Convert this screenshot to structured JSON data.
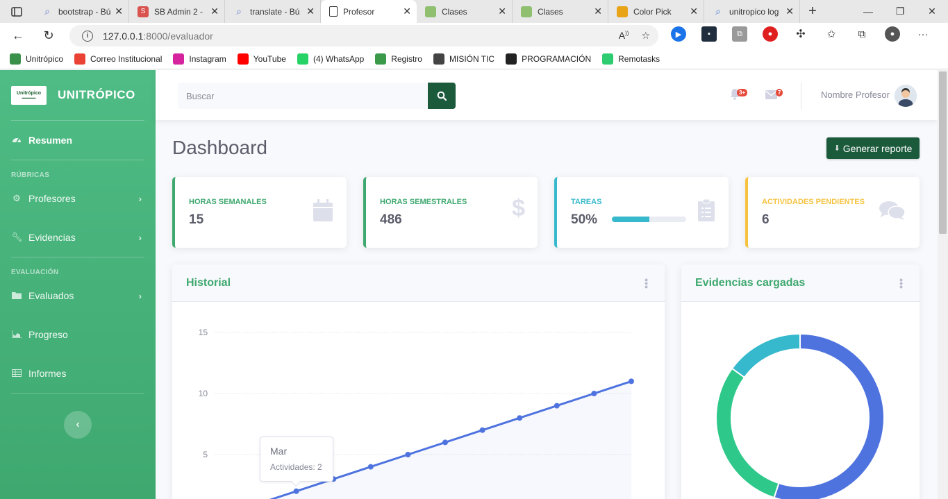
{
  "browser": {
    "tabs": [
      {
        "title": "bootstrap - Bú",
        "icon_color": "#6b7bd3",
        "icon": "search-icon",
        "active": false
      },
      {
        "title": "SB Admin 2 -",
        "icon_color": "#d9534f",
        "icon": "s-logo-icon",
        "active": false
      },
      {
        "title": "translate - Bú",
        "icon_color": "#6b7bd3",
        "icon": "search-icon",
        "active": false
      },
      {
        "title": "Profesor",
        "icon_color": "#ffffff",
        "icon": "document-icon",
        "active": true
      },
      {
        "title": "Clases",
        "icon_color": "#8fbf6f",
        "icon": "classroom-icon",
        "active": false
      },
      {
        "title": "Clases",
        "icon_color": "#8fbf6f",
        "icon": "classroom-icon",
        "active": false
      },
      {
        "title": "Color Pick",
        "icon_color": "#e8a317",
        "icon": "color-picker-icon",
        "active": false
      },
      {
        "title": "unitropico log",
        "icon_color": "#4a7bd3",
        "icon": "search-icon",
        "active": false
      }
    ],
    "url_host": "127.0.0.1",
    "url_path": ":8000/evaluador",
    "bookmarks": [
      {
        "label": "Unitrópico",
        "color": "#3a8f4a",
        "icon": "unitropico-icon"
      },
      {
        "label": "Correo Institucional",
        "color": "#ea4335",
        "icon": "gmail-icon"
      },
      {
        "label": "Instagram",
        "color": "#d6249f",
        "icon": "instagram-icon"
      },
      {
        "label": "YouTube",
        "color": "#ff0000",
        "icon": "youtube-icon"
      },
      {
        "label": "(4) WhatsApp",
        "color": "#25d366",
        "icon": "whatsapp-icon"
      },
      {
        "label": "Registro",
        "color": "#3a9a4a",
        "icon": "registro-icon"
      },
      {
        "label": "MISIÓN TIC",
        "color": "#444444",
        "icon": "mision-tic-icon"
      },
      {
        "label": "PROGRAMACIÓN",
        "color": "#222222",
        "icon": "github-icon"
      },
      {
        "label": "Remotasks",
        "color": "#2ecc71",
        "icon": "remotasks-icon"
      }
    ]
  },
  "sidebar": {
    "brand": "UNITRÓPICO",
    "logo_text": "Unitrópico",
    "items_main": [
      {
        "label": "Resumen",
        "icon": "dashboard-icon"
      }
    ],
    "section1": "RÚBRICAS",
    "items_rubricas": [
      {
        "label": "Profesores",
        "icon": "gear-icon"
      },
      {
        "label": "Evidencias",
        "icon": "wrench-icon"
      }
    ],
    "section2": "EVALUACIÓN",
    "items_eval": [
      {
        "label": "Evaluados",
        "icon": "folder-icon"
      },
      {
        "label": "Progreso",
        "icon": "chart-area-icon"
      },
      {
        "label": "Informes",
        "icon": "table-icon"
      }
    ]
  },
  "topbar": {
    "search_placeholder": "Buscar",
    "alerts_badge": "3+",
    "messages_badge": "7",
    "user_name": "Nombre Profesor"
  },
  "page": {
    "title": "Dashboard",
    "report_button": "Generar reporte"
  },
  "cards": [
    {
      "label": "HORAS SEMANALES",
      "value": "15",
      "color": "#3ea86f",
      "icon": "calendar-icon"
    },
    {
      "label": "HORAS SEMESTRALES",
      "value": "486",
      "color": "#3ea86f",
      "icon": "dollar-icon"
    },
    {
      "label": "TAREAS",
      "value": "50%",
      "color": "#36b9cc",
      "icon": "clipboard-icon",
      "progress": 0.5
    },
    {
      "label": "ACTIVIDADES PENDIENTES",
      "value": "6",
      "color": "#f6c23e",
      "icon": "comments-icon"
    }
  ],
  "panels": {
    "historial_title": "Historial",
    "evidencias_title": "Evidencias cargadas"
  },
  "tooltip": {
    "title": "Mar",
    "body": "Actividades: 2"
  },
  "chart_data": [
    {
      "type": "line",
      "yticks": [
        "15",
        "10",
        "5"
      ],
      "ylim": [
        0,
        15
      ],
      "x": [
        1,
        2,
        3,
        4,
        5,
        6,
        7,
        8,
        9,
        10,
        11
      ],
      "values": [
        1,
        2,
        3,
        4,
        5,
        6,
        7,
        8,
        9,
        10,
        11
      ],
      "line_color": "#4e73df",
      "grid": true
    },
    {
      "type": "pie",
      "donut": true,
      "values": [
        55,
        30,
        15
      ],
      "colors": [
        "#4e73df",
        "#2ec98a",
        "#36b9cc"
      ]
    }
  ]
}
